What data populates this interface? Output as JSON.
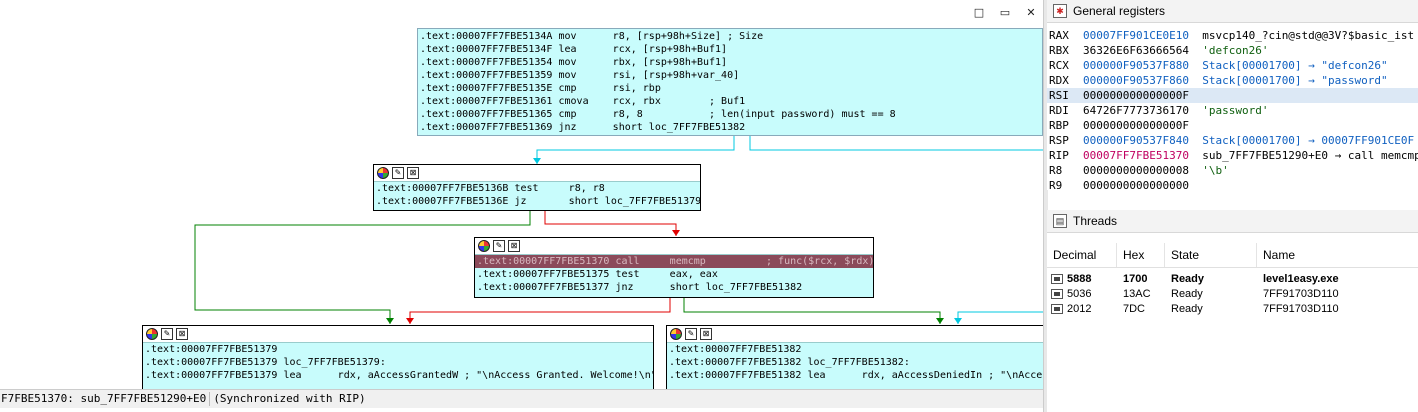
{
  "window_controls": {
    "minimize": "□",
    "restore": "▭",
    "close": "✕"
  },
  "top_block": [
    {
      "addr": ".text:00007FF7FBE5134A",
      "mn": "mov",
      "ops": "r8, [rsp+98h+Size] ; Size"
    },
    {
      "addr": ".text:00007FF7FBE5134F",
      "mn": "lea",
      "ops": "rcx, [rsp+98h+Buf1]"
    },
    {
      "addr": ".text:00007FF7FBE51354",
      "mn": "mov",
      "ops": "rbx, [rsp+98h+Buf1]"
    },
    {
      "addr": ".text:00007FF7FBE51359",
      "mn": "mov",
      "ops": "rsi, [rsp+98h+var_40]"
    },
    {
      "addr": ".text:00007FF7FBE5135E",
      "mn": "cmp",
      "ops": "rsi, rbp"
    },
    {
      "addr": ".text:00007FF7FBE51361",
      "mn": "cmova",
      "ops": "rcx, rbx        ; Buf1"
    },
    {
      "addr": ".text:00007FF7FBE51365",
      "mn": "cmp",
      "ops": "r8, 8           ; len(input password) must == 8"
    },
    {
      "addr": ".text:00007FF7FBE51369",
      "mn": "jnz",
      "ops": "short loc_7FF7FBE51382"
    }
  ],
  "block_test": [
    {
      "addr": ".text:00007FF7FBE5136B",
      "mn": "test",
      "ops": "r8, r8"
    },
    {
      "addr": ".text:00007FF7FBE5136E",
      "mn": "jz",
      "ops": "short loc_7FF7FBE51379"
    }
  ],
  "block_call": [
    {
      "addr": ".text:00007FF7FBE51370",
      "mn": "call",
      "ops": "memcmp          ; func($rcx, $rdx)"
    },
    {
      "addr": ".text:00007FF7FBE51375",
      "mn": "test",
      "ops": "eax, eax"
    },
    {
      "addr": ".text:00007FF7FBE51377",
      "mn": "jnz",
      "ops": "short loc_7FF7FBE51382"
    }
  ],
  "block_granted": [
    {
      "addr": ".text:00007FF7FBE51379",
      "mn": "",
      "ops": ""
    },
    {
      "addr": ".text:00007FF7FBE51379",
      "mn": "loc_7FF7FBE51379:",
      "ops": ""
    },
    {
      "addr": ".text:00007FF7FBE51379",
      "mn": "lea",
      "ops": "rdx, aAccessGrantedW ; \"\\nAccess Granted. Welcome!\\n\""
    }
  ],
  "block_denied": [
    {
      "addr": ".text:00007FF7FBE51382",
      "mn": "",
      "ops": ""
    },
    {
      "addr": ".text:00007FF7FBE51382",
      "mn": "loc_7FF7FBE51382:",
      "ops": ""
    },
    {
      "addr": ".text:00007FF7FBE51382",
      "mn": "lea",
      "ops": "rdx, aAccessDeniedIn ; \"\\nAccess"
    }
  ],
  "status": {
    "location": "F7FBE51370: sub_7FF7FBE51290+E0",
    "sync": "(Synchronized with RIP)"
  },
  "registers_panel": {
    "title": "General registers",
    "regs": [
      {
        "name": "RAX",
        "value": "00007FF901CE0E10",
        "comment": "msvcp140_?cin@std@@3V?$basic_ist",
        "color": "#1060c0"
      },
      {
        "name": "RBX",
        "value": "36326E6F63666564",
        "comment": "'defcon26'",
        "color": "#000000"
      },
      {
        "name": "RCX",
        "value": "000000F90537F880",
        "comment": "Stack[00001700] → \"defcon26\"",
        "color": "#1060c0"
      },
      {
        "name": "RDX",
        "value": "000000F90537F860",
        "comment": "Stack[00001700] → \"password\"",
        "color": "#1060c0"
      },
      {
        "name": "RSI",
        "value": "000000000000000F",
        "comment": "",
        "color": "#000000"
      },
      {
        "name": "RDI",
        "value": "64726F7773736170",
        "comment": "'password'",
        "color": "#000000"
      },
      {
        "name": "RBP",
        "value": "000000000000000F",
        "comment": "",
        "color": "#000000"
      },
      {
        "name": "RSP",
        "value": "000000F90537F840",
        "comment": "Stack[00001700] → 00007FF901CE0F",
        "color": "#1060c0"
      },
      {
        "name": "RIP",
        "value": "00007FF7FBE51370",
        "comment": "sub_7FF7FBE51290+E0 → call memcmp",
        "color": "#c00060"
      },
      {
        "name": "R8",
        "value": "0000000000000008",
        "comment": "'\\b'",
        "color": "#000000"
      },
      {
        "name": "R9",
        "value": "0000000000000000",
        "comment": "",
        "color": "#000000"
      }
    ]
  },
  "threads_panel": {
    "title": "Threads",
    "columns": [
      "Decimal",
      "Hex",
      "State",
      "Name"
    ],
    "rows": [
      {
        "decimal": "5888",
        "hex": "1700",
        "state": "Ready",
        "name": "level1easy.exe",
        "bold": true
      },
      {
        "decimal": "5036",
        "hex": "13AC",
        "state": "Ready",
        "name": "7FF91703D110",
        "bold": false
      },
      {
        "decimal": "2012",
        "hex": "7DC",
        "state": "Ready",
        "name": "7FF91703D110",
        "bold": false
      }
    ]
  },
  "colors": {
    "node_bg": "#c8fcfc",
    "highlight": "#8b4a5a",
    "edge_green": "#008000",
    "edge_red": "#e00000",
    "edge_cyan": "#00c8e0"
  }
}
